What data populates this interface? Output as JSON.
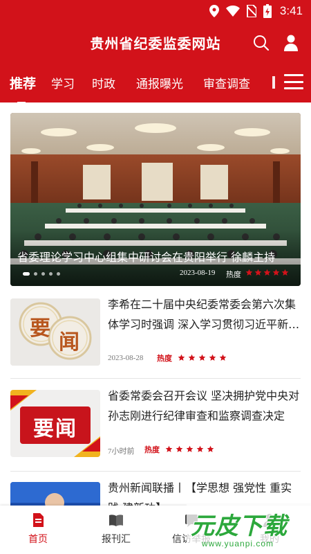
{
  "status_bar": {
    "time": "3:41",
    "icons": [
      "location-icon",
      "wifi-icon",
      "sim-off-icon",
      "battery-charging-icon"
    ]
  },
  "header": {
    "title": "贵州省纪委监委网站",
    "icons": [
      "search-icon",
      "user-icon"
    ]
  },
  "tabs": {
    "items": [
      {
        "label": "推荐",
        "active": true
      },
      {
        "label": "学习"
      },
      {
        "label": "时政"
      },
      {
        "label": "通报曝光"
      },
      {
        "label": "审查调查"
      }
    ],
    "menu_icon": "menu-icon"
  },
  "hero": {
    "title": "省委理论学习中心组集中研讨会在贵阳举行 徐麟主持",
    "date": "2023-08-19",
    "heat_label": "热度",
    "heat_stars": 5,
    "slide_count": 5,
    "active_slide": 0
  },
  "news": [
    {
      "title": "李希在二十届中央纪委常委会第六次集体学习时强调 深入学习贯彻习近平新时代中国特色社会主义思想",
      "thumb_text": [
        "要",
        "闻"
      ],
      "date": "2023-08-28",
      "heat_label": "热度",
      "heat_stars": 5
    },
    {
      "title": "省委常委会召开会议 坚决拥护党中央对孙志刚进行纪律审查和监察调查决定",
      "thumb_text": "要闻",
      "date": "7小时前",
      "heat_label": "热度",
      "heat_stars": 5
    },
    {
      "title": "贵州新闻联播丨【学思想 强党性 重实践 建新功】"
    }
  ],
  "bottom_nav": [
    {
      "label": "首页",
      "icon": "home-document-icon",
      "active": true
    },
    {
      "label": "报刊汇",
      "icon": "book-icon"
    },
    {
      "label": "信访举报",
      "icon": "report-icon"
    },
    {
      "label": "我的",
      "icon": "profile-icon"
    }
  ],
  "watermark": {
    "main": "元皮下载",
    "url": "www.yuanpi.com"
  },
  "colors": {
    "brand_red": "#d2121a",
    "star_red": "#d2121a",
    "watermark_green": "#2ca83c"
  }
}
